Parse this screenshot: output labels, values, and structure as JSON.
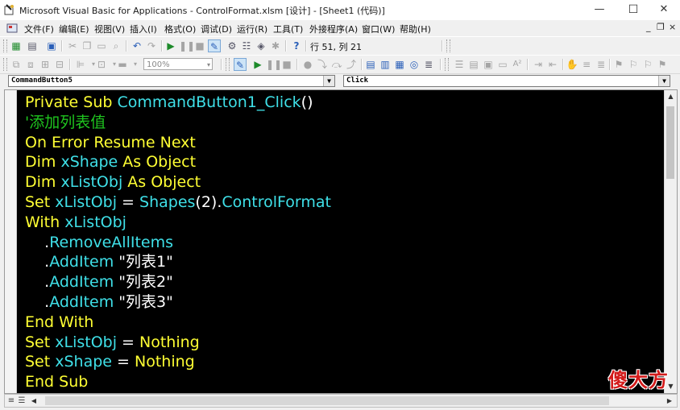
{
  "window": {
    "title": "Microsoft Visual Basic for Applications - ControlFormat.xlsm [设计] - [Sheet1 (代码)]",
    "controls": {
      "minimize": "—",
      "maximize": "☐",
      "close": "✕"
    }
  },
  "menubar": {
    "items": [
      "文件(F)",
      "编辑(E)",
      "视图(V)",
      "插入(I)",
      "格式(O)",
      "调试(D)",
      "运行(R)",
      "工具(T)",
      "外接程序(A)",
      "窗口(W)",
      "帮助(H)"
    ],
    "mdi_controls": {
      "minimize": "_",
      "restore": "❐",
      "close": "×"
    }
  },
  "toolbar": {
    "cursor_position": "行 51, 列 21",
    "zoom": "100%"
  },
  "combos": {
    "object": "CommandButton5",
    "procedure": "Click"
  },
  "code": {
    "lines": [
      [
        {
          "t": "Private Sub ",
          "c": "kw"
        },
        {
          "t": "CommandButton1_Click",
          "c": "id"
        },
        {
          "t": "()",
          "c": "str"
        }
      ],
      [
        {
          "t": "'添加列表值",
          "c": "cm"
        }
      ],
      [
        {
          "t": "On Error Resume Next",
          "c": "kw"
        }
      ],
      [
        {
          "t": "Dim ",
          "c": "kw"
        },
        {
          "t": "xShape",
          "c": "id"
        },
        {
          "t": " As Object",
          "c": "kw"
        }
      ],
      [
        {
          "t": "Dim ",
          "c": "kw"
        },
        {
          "t": "xListObj",
          "c": "id"
        },
        {
          "t": " As Object",
          "c": "kw"
        }
      ],
      [
        {
          "t": "Set ",
          "c": "kw"
        },
        {
          "t": "xListObj",
          "c": "id"
        },
        {
          "t": " = ",
          "c": "str"
        },
        {
          "t": "Shapes",
          "c": "id"
        },
        {
          "t": "(2).",
          "c": "str"
        },
        {
          "t": "ControlFormat",
          "c": "id"
        }
      ],
      [
        {
          "t": "With ",
          "c": "kw"
        },
        {
          "t": "xListObj",
          "c": "id"
        }
      ],
      [
        {
          "t": "    .",
          "c": "str"
        },
        {
          "t": "RemoveAllItems",
          "c": "id"
        }
      ],
      [
        {
          "t": "    .",
          "c": "str"
        },
        {
          "t": "AddItem",
          "c": "id"
        },
        {
          "t": " \"列表1\"",
          "c": "str"
        }
      ],
      [
        {
          "t": "    .",
          "c": "str"
        },
        {
          "t": "AddItem",
          "c": "id"
        },
        {
          "t": " \"列表2\"",
          "c": "str"
        }
      ],
      [
        {
          "t": "    .",
          "c": "str"
        },
        {
          "t": "AddItem",
          "c": "id"
        },
        {
          "t": " \"列表3\"",
          "c": "str"
        }
      ],
      [
        {
          "t": "End With",
          "c": "kw"
        }
      ],
      [
        {
          "t": "Set ",
          "c": "kw"
        },
        {
          "t": "xListObj",
          "c": "id"
        },
        {
          "t": " = ",
          "c": "str"
        },
        {
          "t": "Nothing",
          "c": "kw"
        }
      ],
      [
        {
          "t": "Set ",
          "c": "kw"
        },
        {
          "t": "xShape",
          "c": "id"
        },
        {
          "t": " = ",
          "c": "str"
        },
        {
          "t": "Nothing",
          "c": "kw"
        }
      ],
      [
        {
          "t": "End Sub",
          "c": "kw"
        }
      ]
    ],
    "colors": {
      "background": "#000000",
      "keyword": "#ffff33",
      "identifier": "#3fe0e8",
      "comment": "#1fc51f",
      "plain": "#ffffff"
    }
  },
  "watermark": "傻大方"
}
